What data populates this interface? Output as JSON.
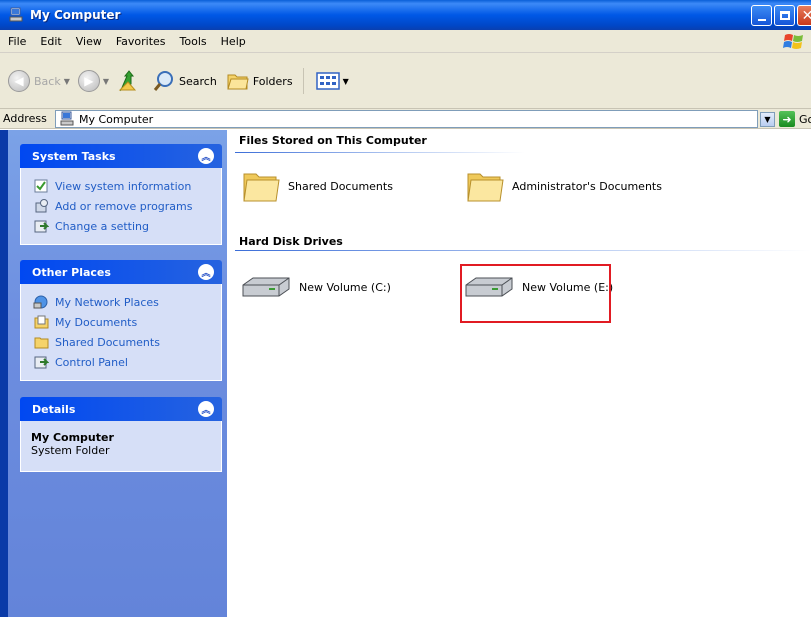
{
  "window": {
    "title": "My Computer"
  },
  "menu": {
    "items": [
      {
        "label": "File"
      },
      {
        "label": "Edit"
      },
      {
        "label": "View"
      },
      {
        "label": "Favorites"
      },
      {
        "label": "Tools"
      },
      {
        "label": "Help"
      }
    ]
  },
  "toolbar": {
    "back_label": "Back",
    "search_label": "Search",
    "folders_label": "Folders"
  },
  "address": {
    "label": "Address",
    "value": "My Computer",
    "go_label": "Go"
  },
  "left": {
    "system_tasks": {
      "title": "System Tasks",
      "items": [
        {
          "label": "View system information",
          "icon": "system-info-icon"
        },
        {
          "label": "Add or remove programs",
          "icon": "add-remove-programs-icon"
        },
        {
          "label": "Change a setting",
          "icon": "control-panel-icon"
        }
      ]
    },
    "other_places": {
      "title": "Other Places",
      "items": [
        {
          "label": "My Network Places",
          "icon": "network-places-icon"
        },
        {
          "label": "My Documents",
          "icon": "my-documents-icon"
        },
        {
          "label": "Shared Documents",
          "icon": "folder-icon"
        },
        {
          "label": "Control Panel",
          "icon": "control-panel-icon"
        }
      ]
    },
    "details": {
      "title": "Details",
      "name": "My Computer",
      "type": "System Folder"
    }
  },
  "content": {
    "groups": [
      {
        "title": "Files Stored on This Computer",
        "items": [
          {
            "label": "Shared Documents",
            "icon": "folder-icon"
          },
          {
            "label": "Administrator's Documents",
            "icon": "folder-icon"
          }
        ]
      },
      {
        "title": "Hard Disk Drives",
        "items": [
          {
            "label": "New Volume (C:)",
            "icon": "hard-drive-icon"
          },
          {
            "label": "New Volume (E:)",
            "icon": "hard-drive-icon"
          }
        ]
      }
    ]
  },
  "colors": {
    "titlebar": "#0058e6",
    "taskpane": "#6d8ee0",
    "link": "#215dc6",
    "highlight": "#e11b23"
  }
}
